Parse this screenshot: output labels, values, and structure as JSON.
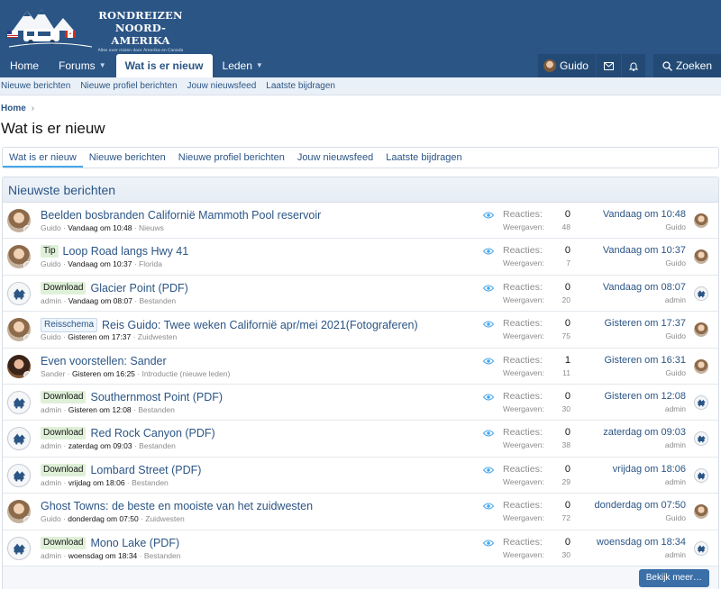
{
  "logo": {
    "line1": "RONDREIZEN",
    "line2": "NOORD-AMERIKA",
    "tagline": "Alles over reizen door Amerika en Canada"
  },
  "nav": {
    "home": "Home",
    "forums": "Forums",
    "whats_new": "Wat is er nieuw",
    "members": "Leden",
    "user": "Guido",
    "search": "Zoeken"
  },
  "subnav": [
    "Nieuwe berichten",
    "Nieuwe profiel berichten",
    "Jouw nieuwsfeed",
    "Laatste bijdragen"
  ],
  "breadcrumb": "Home",
  "page_title": "Wat is er nieuw",
  "tabs": [
    "Wat is er nieuw",
    "Nieuwe berichten",
    "Nieuwe profiel berichten",
    "Jouw nieuwsfeed",
    "Laatste bijdragen"
  ],
  "block_title": "Nieuwste berichten",
  "labels": {
    "replies": "Reacties:",
    "views": "Weergaven:",
    "more": "Bekijk meer…"
  },
  "threads": [
    {
      "prefix": "",
      "title": "Beelden bosbranden Californië Mammoth Pool reservoir",
      "author": "Guido",
      "date": "Vandaag om 10:48",
      "forum": "Nieuws",
      "replies": "0",
      "views": "48",
      "last_date": "Vandaag om 10:48",
      "last_user": "Guido"
    },
    {
      "prefix": "Tip",
      "title": "Loop Road langs Hwy 41",
      "author": "Guido",
      "date": "Vandaag om 10:37",
      "forum": "Florida",
      "replies": "0",
      "views": "7",
      "last_date": "Vandaag om 10:37",
      "last_user": "Guido"
    },
    {
      "prefix": "Download",
      "title": "Glacier Point (PDF)",
      "author": "admin",
      "date": "Vandaag om 08:07",
      "forum": "Bestanden",
      "replies": "0",
      "views": "20",
      "last_date": "Vandaag om 08:07",
      "last_user": "admin"
    },
    {
      "prefix": "Reisschema",
      "title": "Reis Guido: Twee weken Californië apr/mei 2021(Fotograferen)",
      "author": "Guido",
      "date": "Gisteren om 17:37",
      "forum": "Zuidwesten",
      "replies": "0",
      "views": "75",
      "last_date": "Gisteren om 17:37",
      "last_user": "Guido"
    },
    {
      "prefix": "",
      "title": "Even voorstellen: Sander",
      "author": "Sander",
      "date": "Gisteren om 16:25",
      "forum": "Introductie (nieuwe leden)",
      "replies": "1",
      "views": "11",
      "last_date": "Gisteren om 16:31",
      "last_user": "Guido"
    },
    {
      "prefix": "Download",
      "title": "Southernmost Point (PDF)",
      "author": "admin",
      "date": "Gisteren om 12:08",
      "forum": "Bestanden",
      "replies": "0",
      "views": "30",
      "last_date": "Gisteren om 12:08",
      "last_user": "admin"
    },
    {
      "prefix": "Download",
      "title": "Red Rock Canyon (PDF)",
      "author": "admin",
      "date": "zaterdag om 09:03",
      "forum": "Bestanden",
      "replies": "0",
      "views": "38",
      "last_date": "zaterdag om 09:03",
      "last_user": "admin"
    },
    {
      "prefix": "Download",
      "title": "Lombard Street (PDF)",
      "author": "admin",
      "date": "vrijdag om 18:06",
      "forum": "Bestanden",
      "replies": "0",
      "views": "29",
      "last_date": "vrijdag om 18:06",
      "last_user": "admin"
    },
    {
      "prefix": "",
      "title": "Ghost Towns: de beste en mooiste van het zuidwesten",
      "author": "Guido",
      "date": "donderdag om 07:50",
      "forum": "Zuidwesten",
      "replies": "0",
      "views": "72",
      "last_date": "donderdag om 07:50",
      "last_user": "Guido"
    },
    {
      "prefix": "Download",
      "title": "Mono Lake (PDF)",
      "author": "admin",
      "date": "woensdag om 18:34",
      "forum": "Bestanden",
      "replies": "0",
      "views": "30",
      "last_date": "woensdag om 18:34",
      "last_user": "admin"
    }
  ],
  "colors": {
    "header": "#2b5585",
    "link": "#2b5585",
    "prefix_green": "#dff0d8",
    "button": "#3a6fa8"
  }
}
